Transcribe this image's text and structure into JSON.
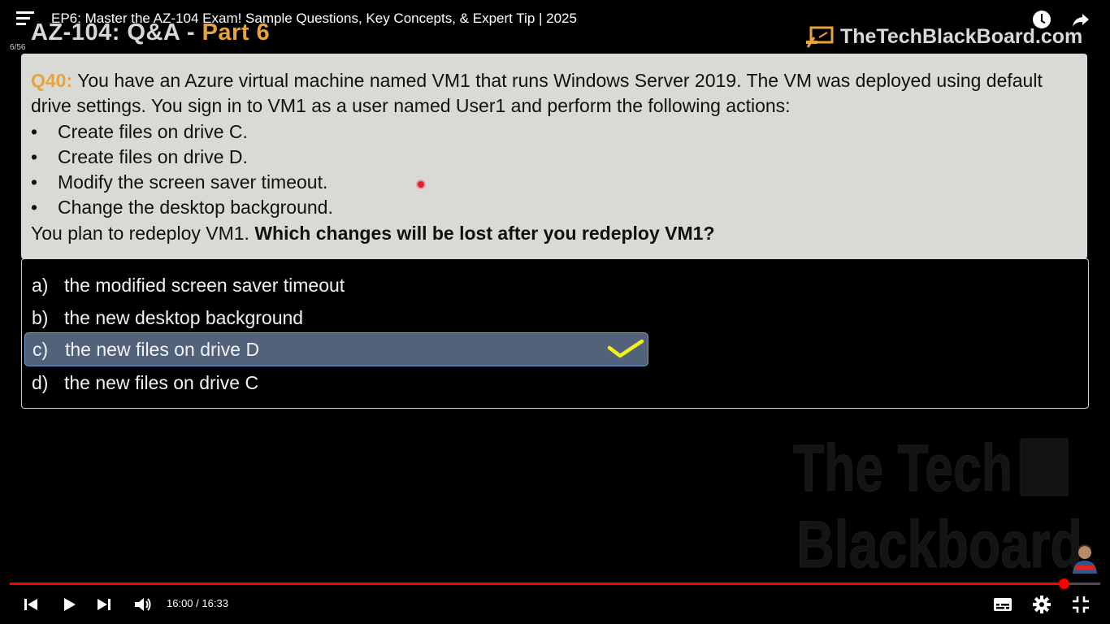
{
  "player": {
    "title": "EP6: Master the AZ-104 Exam! Sample Questions, Key Concepts, & Expert Tip | 2025",
    "chapter_counter": "6/56",
    "current_time": "16:00",
    "separator": " / ",
    "duration": "16:33",
    "progress_fraction": 0.9665,
    "accent_color": "#ff0000",
    "icons": [
      "menu-icon",
      "clock-icon",
      "share-icon",
      "previous-icon",
      "play-icon",
      "next-icon",
      "volume-icon",
      "subtitles-icon",
      "settings-icon",
      "exit-fullscreen-icon"
    ]
  },
  "slide": {
    "title_prefix": "AZ-104: Q&A - ",
    "title_accent": "Part 6",
    "brand": "TheTechBlackBoard.com",
    "question": {
      "number": "Q40:",
      "line1": " You have an Azure virtual machine named VM1 that runs Windows Server 2019. The VM was deployed using default",
      "line2": "drive settings. You sign in to VM1 as a user named User1 and perform the following actions:",
      "bullets": [
        "Create files on drive C.",
        "Create files on drive D.",
        "Modify the screen saver timeout.",
        "Change the desktop background."
      ],
      "closing_plain": "You plan to redeploy VM1. ",
      "closing_bold": "Which changes will be lost after you redeploy VM1?"
    },
    "answers": [
      {
        "letter": "a)",
        "text": "the modified screen saver timeout"
      },
      {
        "letter": "b)",
        "text": "the new desktop background"
      },
      {
        "letter": "c)",
        "text": "the new files on drive D"
      },
      {
        "letter": "d)",
        "text": "the new files on drive C"
      }
    ],
    "correct_answer": "c)",
    "colors": {
      "accent_orange": "#e8a33c",
      "question_bg": "#d9d9d6",
      "selected_bg": "#51627a",
      "check_color": "#f2f21a"
    },
    "watermark_lines": [
      "The Tech",
      "Blackboard"
    ]
  }
}
